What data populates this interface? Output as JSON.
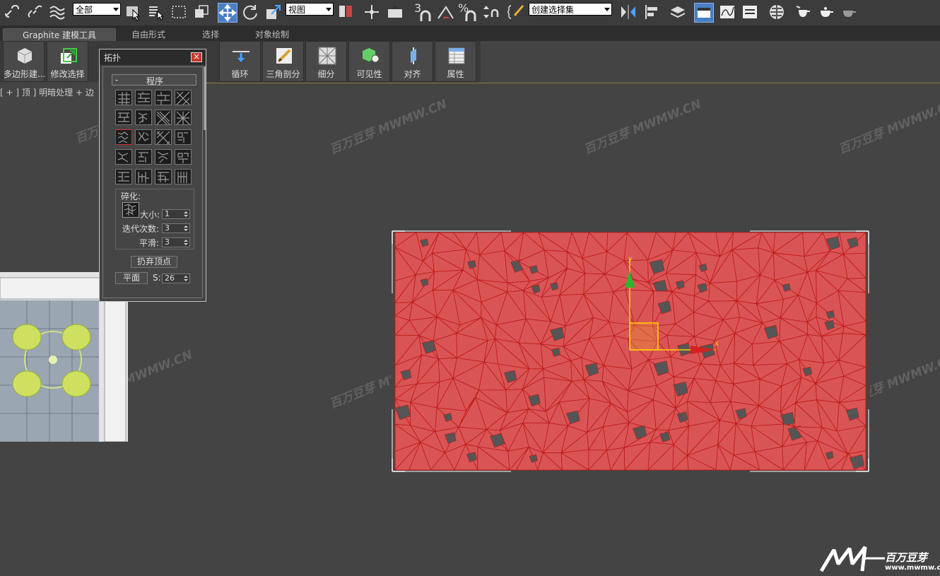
{
  "toolbar": {
    "selection_filter": "全部",
    "reference_coord": "视图",
    "named_selection": "创建选择集",
    "snap_3": "3",
    "snap_pct": "%"
  },
  "ribbon_tabs": [
    {
      "label": "Graphite 建模工具"
    },
    {
      "label": "自由形式"
    },
    {
      "label": "选择"
    },
    {
      "label": "对象绘制"
    }
  ],
  "ribbon_buttons": [
    {
      "label": "多边形建..."
    },
    {
      "label": "修改选择"
    },
    {
      "label": "循环"
    },
    {
      "label": "三角剖分"
    },
    {
      "label": "细分"
    },
    {
      "label": "可见性"
    },
    {
      "label": "对齐"
    },
    {
      "label": "属性"
    }
  ],
  "viewport": {
    "label": "[ + ] 顶 ] 明暗处理 + 边",
    "axis_x": "x",
    "axis_y": "y"
  },
  "panel": {
    "title": "拓扑",
    "section_sign": "-",
    "section": "程序",
    "group": "碎化:",
    "size_label": "大小:",
    "size_value": "1",
    "iter_label": "迭代次数:",
    "iter_value": "3",
    "smooth_label": "平滑:",
    "smooth_value": "3",
    "discard_button": "扔弃顶点",
    "flat_button": "平面",
    "s_label": "S:",
    "s_value": "26",
    "close": "×"
  },
  "watermark": {
    "text": "百万豆芽 MWMW.CN",
    "logo_text": "百万豆芽",
    "logo_url": "www.mwmw.cn"
  },
  "colors": {
    "mesh_fill": "#d95555",
    "mesh_edge": "#c01818",
    "hole": "#555555",
    "viewport_bg": "#444444"
  }
}
